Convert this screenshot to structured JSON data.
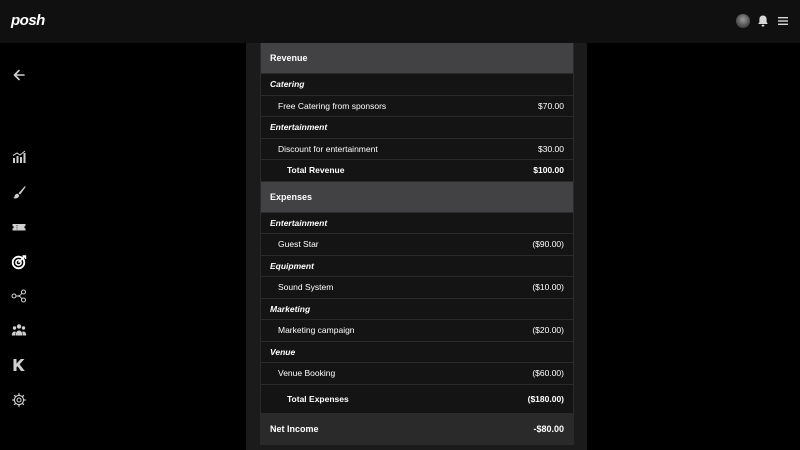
{
  "app": {
    "logo": "posh"
  },
  "header": {
    "avatar_icon": "user-avatar",
    "notification_icon": "bell-icon",
    "menu_icon": "hamburger-menu-icon"
  },
  "sidebar": {
    "back_icon": "arrow-left-icon",
    "items": [
      {
        "name": "analytics",
        "icon": "bar-chart-icon"
      },
      {
        "name": "design",
        "icon": "paintbrush-icon"
      },
      {
        "name": "tickets",
        "icon": "ticket-icon"
      },
      {
        "name": "finance",
        "icon": "target-icon",
        "active": true
      },
      {
        "name": "share",
        "icon": "network-icon"
      },
      {
        "name": "team",
        "icon": "people-icon"
      },
      {
        "name": "kickback",
        "icon": "k-icon"
      },
      {
        "name": "settings",
        "icon": "gear-icon"
      }
    ]
  },
  "report": {
    "revenue": {
      "title": "Revenue",
      "categories": [
        {
          "name": "Catering",
          "items": [
            {
              "label": "Free Catering from sponsors",
              "amount": "$70.00"
            }
          ]
        },
        {
          "name": "Entertainment",
          "items": [
            {
              "label": "Discount for entertainment",
              "amount": "$30.00"
            }
          ]
        }
      ],
      "total_label": "Total Revenue",
      "total_amount": "$100.00"
    },
    "expenses": {
      "title": "Expenses",
      "categories": [
        {
          "name": "Entertainment",
          "items": [
            {
              "label": "Guest Star",
              "amount": "($90.00)"
            }
          ]
        },
        {
          "name": "Equipment",
          "items": [
            {
              "label": "Sound System",
              "amount": "($10.00)"
            }
          ]
        },
        {
          "name": "Marketing",
          "items": [
            {
              "label": "Marketing campaign",
              "amount": "($20.00)"
            }
          ]
        },
        {
          "name": "Venue",
          "items": [
            {
              "label": "Venue Booking",
              "amount": "($60.00)"
            }
          ]
        }
      ],
      "total_label": "Total Expenses",
      "total_amount": "($180.00)"
    },
    "net_income": {
      "label": "Net Income",
      "amount": "-$80.00"
    }
  }
}
